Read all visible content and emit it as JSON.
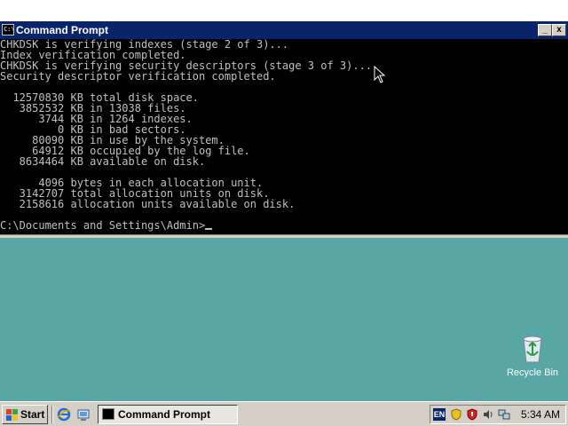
{
  "window": {
    "title": "Command Prompt",
    "minimize_glyph": "_",
    "close_glyph": "x",
    "console_lines": [
      "CHKDSK is verifying indexes (stage 2 of 3)...",
      "Index verification completed.",
      "CHKDSK is verifying security descriptors (stage 3 of 3)...",
      "Security descriptor verification completed.",
      "",
      "  12570830 KB total disk space.",
      "   3852532 KB in 13038 files.",
      "      3744 KB in 1264 indexes.",
      "         0 KB in bad sectors.",
      "     80090 KB in use by the system.",
      "     64912 KB occupied by the log file.",
      "   8634464 KB available on disk.",
      "",
      "      4096 bytes in each allocation unit.",
      "   3142707 total allocation units on disk.",
      "   2158616 allocation units available on disk.",
      ""
    ],
    "prompt": "C:\\Documents and Settings\\Admin>"
  },
  "desktop": {
    "recycle_bin_label": "Recycle Bin"
  },
  "taskbar": {
    "start_label": "Start",
    "quick_launch": [
      "internet-explorer-icon",
      "show-desktop-icon"
    ],
    "task_label": "Command Prompt",
    "tray": {
      "language": "EN",
      "icons": [
        "security-shield-icon",
        "security-alert-icon",
        "volume-icon",
        "network-icon"
      ],
      "clock": "5:34 AM"
    }
  },
  "colors": {
    "desktop": "#58a6a5",
    "titlebar": "#0a246a",
    "console_bg": "#000000",
    "console_text": "#c0c0c0",
    "taskbar": "#d4d0c8"
  }
}
